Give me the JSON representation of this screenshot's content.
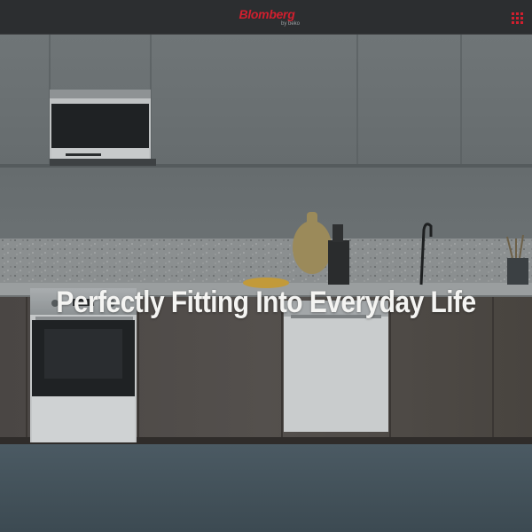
{
  "header": {
    "brand": "Blomberg",
    "brand_sub": "by beko",
    "menu_icon": "grid-menu-icon"
  },
  "hero": {
    "headline": "Perfectly Fitting Into Everyday Life"
  },
  "colors": {
    "brand_red": "#d11f2e",
    "header_bg": "#2c2e30"
  }
}
